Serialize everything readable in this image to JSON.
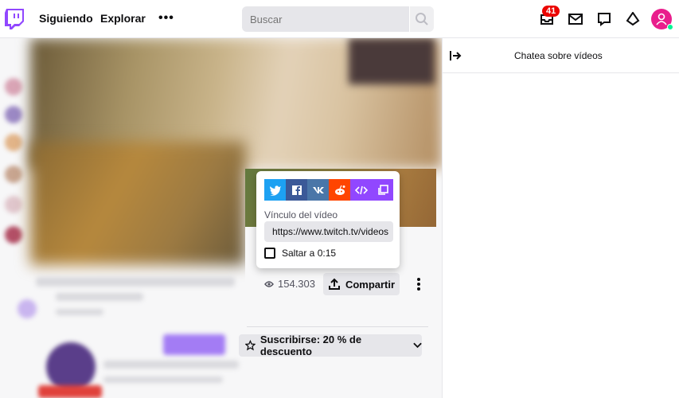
{
  "topbar": {
    "nav": [
      "Siguiendo",
      "Explorar"
    ],
    "more_label": "•••",
    "search_placeholder": "Buscar",
    "inbox_badge": "41"
  },
  "video": {
    "views": "154.303",
    "share_label": "Compartir",
    "subscribe_label": "Suscribirse: 20 % de descuento"
  },
  "share_popup": {
    "services": [
      {
        "name": "twitter",
        "color": "#1da1f2"
      },
      {
        "name": "facebook",
        "color": "#3b5998"
      },
      {
        "name": "vk",
        "color": "#4a76a8"
      },
      {
        "name": "reddit",
        "color": "#ff4500"
      },
      {
        "name": "embed",
        "color": "#9147ff"
      },
      {
        "name": "copy",
        "color": "#9147ff"
      }
    ],
    "link_label": "Vínculo del vídeo",
    "link_value": "https://www.twitch.tv/videos",
    "skip_label": "Saltar a 0:15"
  },
  "chat": {
    "title": "Chatea sobre vídeos"
  },
  "colors": {
    "brand": "#9147ff",
    "badge": "#eb0400",
    "avatar": "#e91e8c"
  }
}
